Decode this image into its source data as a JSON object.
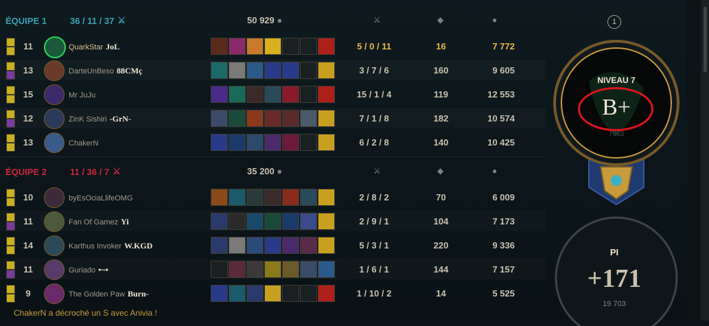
{
  "team1": {
    "label": "ÉQUIPE 1",
    "kda": "36 / 11 / 37",
    "gold": "50 929"
  },
  "team2": {
    "label": "ÉQUIPE 2",
    "kda": "11 / 36 / 7",
    "gold": "35 200"
  },
  "players1": [
    {
      "level": "11",
      "name": "QuarkStar",
      "tag": "JoL",
      "kda": "5 / 0 / 11",
      "cs": "16",
      "gold": "7 772",
      "me": true
    },
    {
      "level": "13",
      "name": "DarteUnBeso",
      "tag": "88CMç",
      "kda": "3 / 7 / 6",
      "cs": "160",
      "gold": "9 605"
    },
    {
      "level": "15",
      "name": "Mr JuJu",
      "tag": "",
      "kda": "15 / 1 / 4",
      "cs": "119",
      "gold": "12 553"
    },
    {
      "level": "12",
      "name": "ZinK Sishiri",
      "tag": "-GrN-",
      "kda": "7 / 1 / 8",
      "cs": "182",
      "gold": "10 574"
    },
    {
      "level": "13",
      "name": "ChakerN",
      "tag": "",
      "kda": "6 / 2 / 8",
      "cs": "140",
      "gold": "10 425"
    }
  ],
  "players2": [
    {
      "level": "10",
      "name": "byEsOciaLlifeOMG",
      "tag": "",
      "kda": "2 / 8 / 2",
      "cs": "70",
      "gold": "6 009"
    },
    {
      "level": "11",
      "name": "Fan Of Gamez",
      "tag": "Yi",
      "kda": "2 / 9 / 1",
      "cs": "104",
      "gold": "7 173"
    },
    {
      "level": "14",
      "name": "Karthus Invoker",
      "tag": "W.KGD",
      "kda": "5 / 3 / 1",
      "cs": "220",
      "gold": "9 336"
    },
    {
      "level": "11",
      "name": "Guriado",
      "tag": "•~•",
      "kda": "1 / 6 / 1",
      "cs": "144",
      "gold": "7 157"
    },
    {
      "level": "9",
      "name": "The Golden Paw",
      "tag": "Burn-",
      "kda": "1 / 10 / 2",
      "cs": "14",
      "gold": "5 525"
    }
  ],
  "mastery": {
    "count": "1",
    "level_label": "NIVEAU 7",
    "grade": "B+",
    "sub": "7963"
  },
  "pi": {
    "label": "PI",
    "value": "+171",
    "total": "19 703"
  },
  "footer": "ChakerN a décroché un S avec Anivia !",
  "colors": {
    "team1": "#3aa0b6",
    "team2": "#c8283a",
    "gold": "#c89b3c",
    "highlight": "#e8b84a",
    "annotation": "#e0141e"
  }
}
